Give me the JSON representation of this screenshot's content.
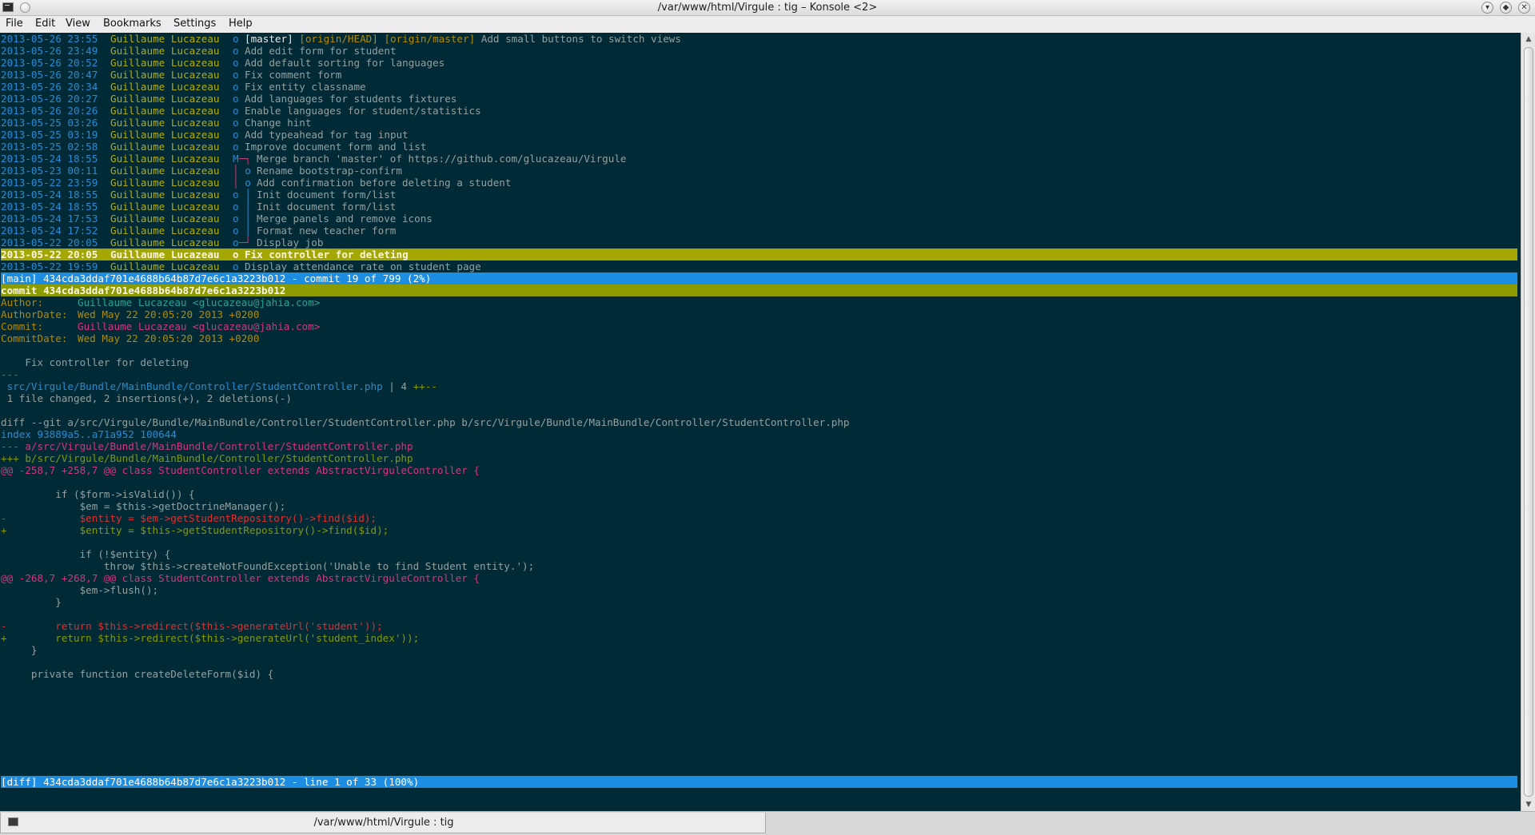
{
  "window": {
    "title": "/var/www/html/Virgule : tig – Konsole <2>",
    "controls": [
      "minimize-icon",
      "maximize-icon",
      "close-icon"
    ]
  },
  "menu": [
    "File",
    "Edit",
    "View",
    "Bookmarks",
    "Settings",
    "Help"
  ],
  "log": [
    {
      "date": "2013-05-26 23:55",
      "author": "Guillaume Lucazeau",
      "graph": "o",
      "refs": [
        {
          "text": "[master]",
          "color": "white"
        },
        {
          "text": "[origin/HEAD]",
          "color": "yellow"
        },
        {
          "text": "[origin/master]",
          "color": "yellow"
        }
      ],
      "msg": "Add small buttons to switch views"
    },
    {
      "date": "2013-05-26 23:49",
      "author": "Guillaume Lucazeau",
      "graph": "o",
      "msg": "Add edit form for student"
    },
    {
      "date": "2013-05-26 20:52",
      "author": "Guillaume Lucazeau",
      "graph": "o",
      "msg": "Add default sorting for languages"
    },
    {
      "date": "2013-05-26 20:47",
      "author": "Guillaume Lucazeau",
      "graph": "o",
      "msg": "Fix comment form"
    },
    {
      "date": "2013-05-26 20:34",
      "author": "Guillaume Lucazeau",
      "graph": "o",
      "msg": "Fix entity classname"
    },
    {
      "date": "2013-05-26 20:27",
      "author": "Guillaume Lucazeau",
      "graph": "o",
      "msg": "Add languages for students fixtures"
    },
    {
      "date": "2013-05-26 20:26",
      "author": "Guillaume Lucazeau",
      "graph": "o",
      "msg": "Enable languages for student/statistics"
    },
    {
      "date": "2013-05-25 03:26",
      "author": "Guillaume Lucazeau",
      "graph": "o",
      "msg": "Change hint"
    },
    {
      "date": "2013-05-25 03:19",
      "author": "Guillaume Lucazeau",
      "graph": "o",
      "msg": "Add typeahead for tag input"
    },
    {
      "date": "2013-05-25 02:58",
      "author": "Guillaume Lucazeau",
      "graph": "o",
      "msg": "Improve document form and list"
    },
    {
      "date": "2013-05-24 18:55",
      "author": "Guillaume Lucazeau",
      "graph": "M─┐",
      "msg": "Merge branch 'master' of https://github.com/glucazeau/Virgule"
    },
    {
      "date": "2013-05-23 00:11",
      "author": "Guillaume Lucazeau",
      "graph": "│ o",
      "msg": "Rename bootstrap-confirm"
    },
    {
      "date": "2013-05-22 23:59",
      "author": "Guillaume Lucazeau",
      "graph": "│ o",
      "msg": "Add confirmation before deleting a student"
    },
    {
      "date": "2013-05-24 18:55",
      "author": "Guillaume Lucazeau",
      "graph": "o │",
      "msg": "Init document form/list"
    },
    {
      "date": "2013-05-24 18:55",
      "author": "Guillaume Lucazeau",
      "graph": "o │",
      "msg": "Init document form/list"
    },
    {
      "date": "2013-05-24 17:53",
      "author": "Guillaume Lucazeau",
      "graph": "o │",
      "msg": "Merge panels and remove icons"
    },
    {
      "date": "2013-05-24 17:52",
      "author": "Guillaume Lucazeau",
      "graph": "o │",
      "msg": "Format new teacher form"
    },
    {
      "date": "2013-05-22 20:05",
      "author": "Guillaume Lucazeau",
      "graph": "o─┘",
      "msg": "Display job"
    },
    {
      "date": "2013-05-22 20:05",
      "author": "Guillaume Lucazeau",
      "graph": "o",
      "msg": "Fix controller for deleting",
      "selected": true
    },
    {
      "date": "2013-05-22 19:59",
      "author": "Guillaume Lucazeau",
      "graph": "o",
      "msg": "Display attendance rate on student page"
    }
  ],
  "main_status": "[main] 434cda3ddaf701e4688b64b87d7e6c1a3223b012 - commit 19 of 799 (2%)",
  "diff": {
    "commit_line": "commit 434cda3ddaf701e4688b64b87d7e6c1a3223b012",
    "author_label": "Author:",
    "author_value": "Guillaume Lucazeau <glucazeau@jahia.com>",
    "authordate_label": "AuthorDate:",
    "authordate_value": "Wed May 22 20:05:20 2013 +0200",
    "commit_label": "Commit:",
    "commit_value": "Guillaume Lucazeau <glucazeau@jahia.com>",
    "commitdate_label": "CommitDate:",
    "commitdate_value": "Wed May 22 20:05:20 2013 +0200",
    "message": "    Fix controller for deleting",
    "sep": "---",
    "stat_file": " src/Virgule/Bundle/MainBundle/Controller/StudentController.php",
    "stat_count": " | 4 ",
    "stat_bar": "++--",
    "stat_summary": " 1 file changed, 2 insertions(+), 2 deletions(-)",
    "diff_git": "diff --git a/src/Virgule/Bundle/MainBundle/Controller/StudentController.php b/src/Virgule/Bundle/MainBundle/Controller/StudentController.php",
    "index": "index 93889a5..a71a952 100644",
    "minus_file": "--- a/src/Virgule/Bundle/MainBundle/Controller/StudentController.php",
    "plus_file": "+++ b/src/Virgule/Bundle/MainBundle/Controller/StudentController.php",
    "hunk1": "@@ -258,7 +258,7 @@ class StudentController extends AbstractVirguleController {",
    "h1_l1": "         if ($form->isValid()) {",
    "h1_l2": "             $em = $this->getDoctrineManager();",
    "h1_del": "-            $entity = $em->getStudentRepository()->find($id);",
    "h1_add": "+            $entity = $this->getStudentRepository()->find($id);",
    "h1_l3": "             if (!$entity) {",
    "h1_l4": "                 throw $this->createNotFoundException('Unable to find Student entity.');",
    "hunk2": "@@ -268,7 +268,7 @@ class StudentController extends AbstractVirguleController {",
    "h2_l1": "             $em->flush();",
    "h2_l2": "         }",
    "h2_del": "-        return $this->redirect($this->generateUrl('student'));",
    "h2_add": "+        return $this->redirect($this->generateUrl('student_index'));",
    "h2_l3": "     }",
    "h2_l4": "     private function createDeleteForm($id) {"
  },
  "diff_status": "[diff] 434cda3ddaf701e4688b64b87d7e6c1a3223b012 - line 1 of 33 (100%)",
  "tab": {
    "label": "/var/www/html/Virgule : tig"
  }
}
